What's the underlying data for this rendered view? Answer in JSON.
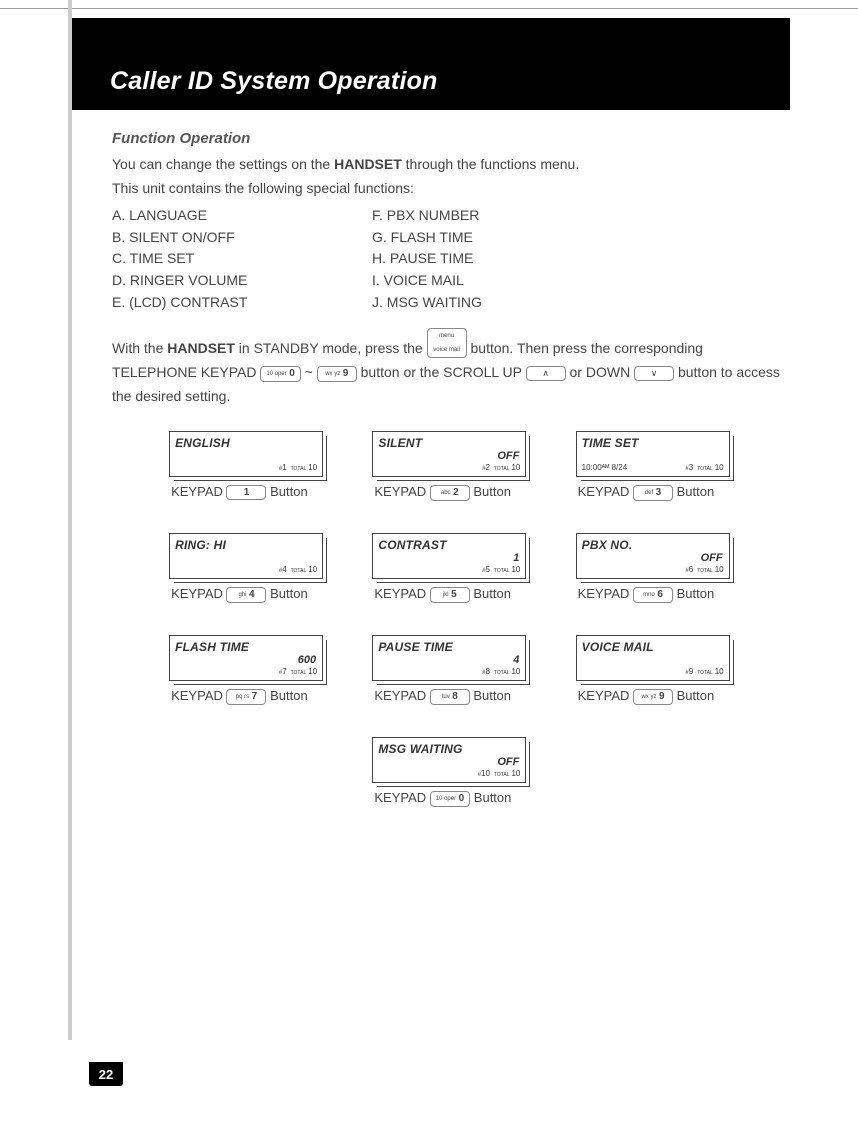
{
  "banner": {
    "title": "Caller ID System Operation"
  },
  "section": {
    "heading": "Function Operation",
    "intro1_pre": "You can change the settings on the ",
    "intro1_bold": "HANDSET",
    "intro1_post": " through the functions menu.",
    "intro2": "This unit contains the following special functions:"
  },
  "functions_left": [
    "A.   LANGUAGE",
    "B.   SILENT ON/OFF",
    "C.   TIME SET",
    "D.   RINGER VOLUME",
    "E.   (LCD) CONTRAST"
  ],
  "functions_right": [
    "F.    PBX NUMBER",
    "G.   FLASH TIME",
    "H.   PAUSE TIME",
    "I.     VOICE MAIL",
    "J.    MSG WAITING"
  ],
  "instructions": {
    "t1": "With the ",
    "t1b": "HANDSET",
    "t2": " in STANDBY mode, press the ",
    "menu_btn_top": "menu",
    "menu_btn_bot": "voice mail",
    "t3": " button. Then press the corresponding TELEPHONE KEYPAD ",
    "kp_first_small": "10 oper",
    "kp_first_big": "0",
    "tilde": "  ~  ",
    "kp_last_small": "wx yz",
    "kp_last_big": "9",
    "t4": " button or the SCROLL UP ",
    "up_arrow": "∧",
    "t5": " or DOWN ",
    "down_arrow": "∨",
    "t6": " button to access the desired setting."
  },
  "items": [
    {
      "title": "ENGLISH",
      "value": "",
      "extra": "",
      "num": "1",
      "total": "10",
      "kp_small": "",
      "kp_big": "1"
    },
    {
      "title": "SILENT",
      "value": "OFF",
      "extra": "",
      "num": "2",
      "total": "10",
      "kp_small": "abc",
      "kp_big": "2"
    },
    {
      "title": "TIME SET",
      "value": "",
      "extra": "10:00ᴬᴹ   8/24",
      "num": "3",
      "total": "10",
      "kp_small": "def",
      "kp_big": "3"
    },
    {
      "title": "RING: HI",
      "value": "",
      "extra": "",
      "num": "4",
      "total": "10",
      "kp_small": "ghi",
      "kp_big": "4"
    },
    {
      "title": "CONTRAST",
      "value": "1",
      "extra": "",
      "num": "5",
      "total": "10",
      "kp_small": "jkl",
      "kp_big": "5"
    },
    {
      "title": "PBX NO.",
      "value": "OFF",
      "extra": "",
      "num": "6",
      "total": "10",
      "kp_small": "mno",
      "kp_big": "6"
    },
    {
      "title": "FLASH TIME",
      "value": "600",
      "extra": "",
      "num": "7",
      "total": "10",
      "kp_small": "pq rs",
      "kp_big": "7"
    },
    {
      "title": "PAUSE TIME",
      "value": "4",
      "extra": "",
      "num": "8",
      "total": "10",
      "kp_small": "tuv",
      "kp_big": "8"
    },
    {
      "title": "VOICE MAIL",
      "value": "",
      "extra": "",
      "num": "9",
      "total": "10",
      "kp_small": "wx yz",
      "kp_big": "9"
    },
    {
      "title": "MSG WAITING",
      "value": "OFF",
      "extra": "",
      "num": "10",
      "total": "10",
      "kp_small": "10 oper",
      "kp_big": "0"
    }
  ],
  "caption": {
    "prefix": "KEYPAD ",
    "suffix": " Button"
  },
  "page_number": "22"
}
